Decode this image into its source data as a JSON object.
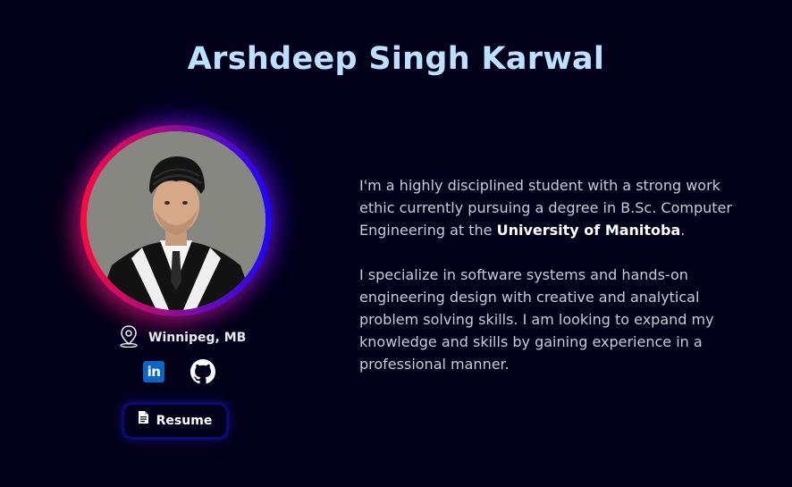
{
  "header": {
    "name": "Arshdeep Singh Karwal"
  },
  "profile": {
    "photo_icon": "profile-photo",
    "location": "Winnipeg, MB",
    "location_icon": "map-pin-icon",
    "ring_colors": [
      "#ff0a3c",
      "#9a0d8a",
      "#1b06ff"
    ]
  },
  "socials": {
    "linkedin_label": "in",
    "linkedin_icon": "linkedin-icon",
    "github_icon": "github-icon",
    "linkedin_color": "#0a66c2"
  },
  "resume": {
    "label": "Resume",
    "icon": "document-icon"
  },
  "bio": {
    "p1_before": "I'm a highly disciplined student with a strong work ethic currently pursuing a degree in B.Sc. Computer Engineering at the ",
    "p1_bold": "University of Manitoba",
    "p1_after": ".",
    "p2": "I specialize in software systems and hands-on engineering design with creative and analytical problem solving skills. I am looking to expand my knowledge and skills by gaining experience in a professional manner."
  },
  "colors": {
    "background": "#03011a",
    "title": "#bde0fe",
    "accent_button_border": "#0b0b7a"
  }
}
